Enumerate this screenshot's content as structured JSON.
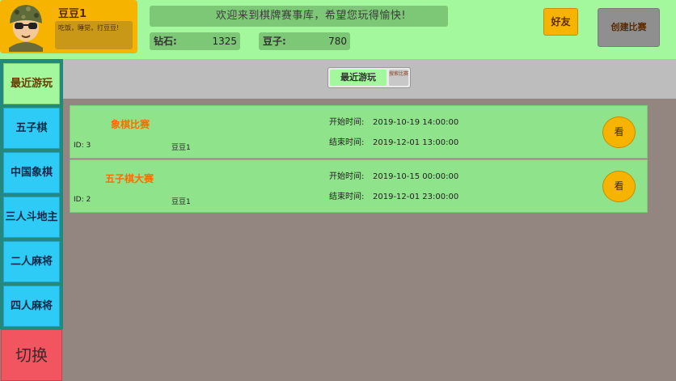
{
  "header": {
    "nickname": "豆豆1",
    "signature": "吃饭，睡觉，打豆豆!",
    "welcome": "欢迎来到棋牌赛事库，希望您玩得愉快!",
    "diamond_label": "钻石:",
    "diamond_value": "1325",
    "bean_label": "豆子:",
    "bean_value": "780",
    "friends_label": "好友",
    "create_label": "创建比赛"
  },
  "sidebar": {
    "items": [
      {
        "label": "最近游玩"
      },
      {
        "label": "五子棋"
      },
      {
        "label": "中国象棋"
      },
      {
        "label": "三人斗地主"
      },
      {
        "label": "二人麻将"
      },
      {
        "label": "四人麻将"
      }
    ],
    "switch_label": "切换"
  },
  "tabs": {
    "recent_label": "最近游玩",
    "search_label": "搜索比赛"
  },
  "matches": [
    {
      "name": "象棋比赛",
      "id": "ID: 3",
      "owner": "豆豆1",
      "start_label": "开始时间:",
      "start": "2019-10-19 14:00:00",
      "end_label": "结束时间:",
      "end": "2019-12-01 13:00:00",
      "view_label": "看"
    },
    {
      "name": "五子棋大赛",
      "id": "ID: 2",
      "owner": "豆豆1",
      "start_label": "开始时间:",
      "start": "2019-10-15 00:00:00",
      "end_label": "结束时间:",
      "end": "2019-12-01 23:00:00",
      "view_label": "看"
    }
  ],
  "colors": {
    "header_bg": "#a3f79c",
    "accent_orange": "#f6b400",
    "sidebar_item": "#2dcbf6",
    "switch_button": "#f25560",
    "card_bg": "#8fe38a",
    "match_name": "#ff6a00"
  }
}
